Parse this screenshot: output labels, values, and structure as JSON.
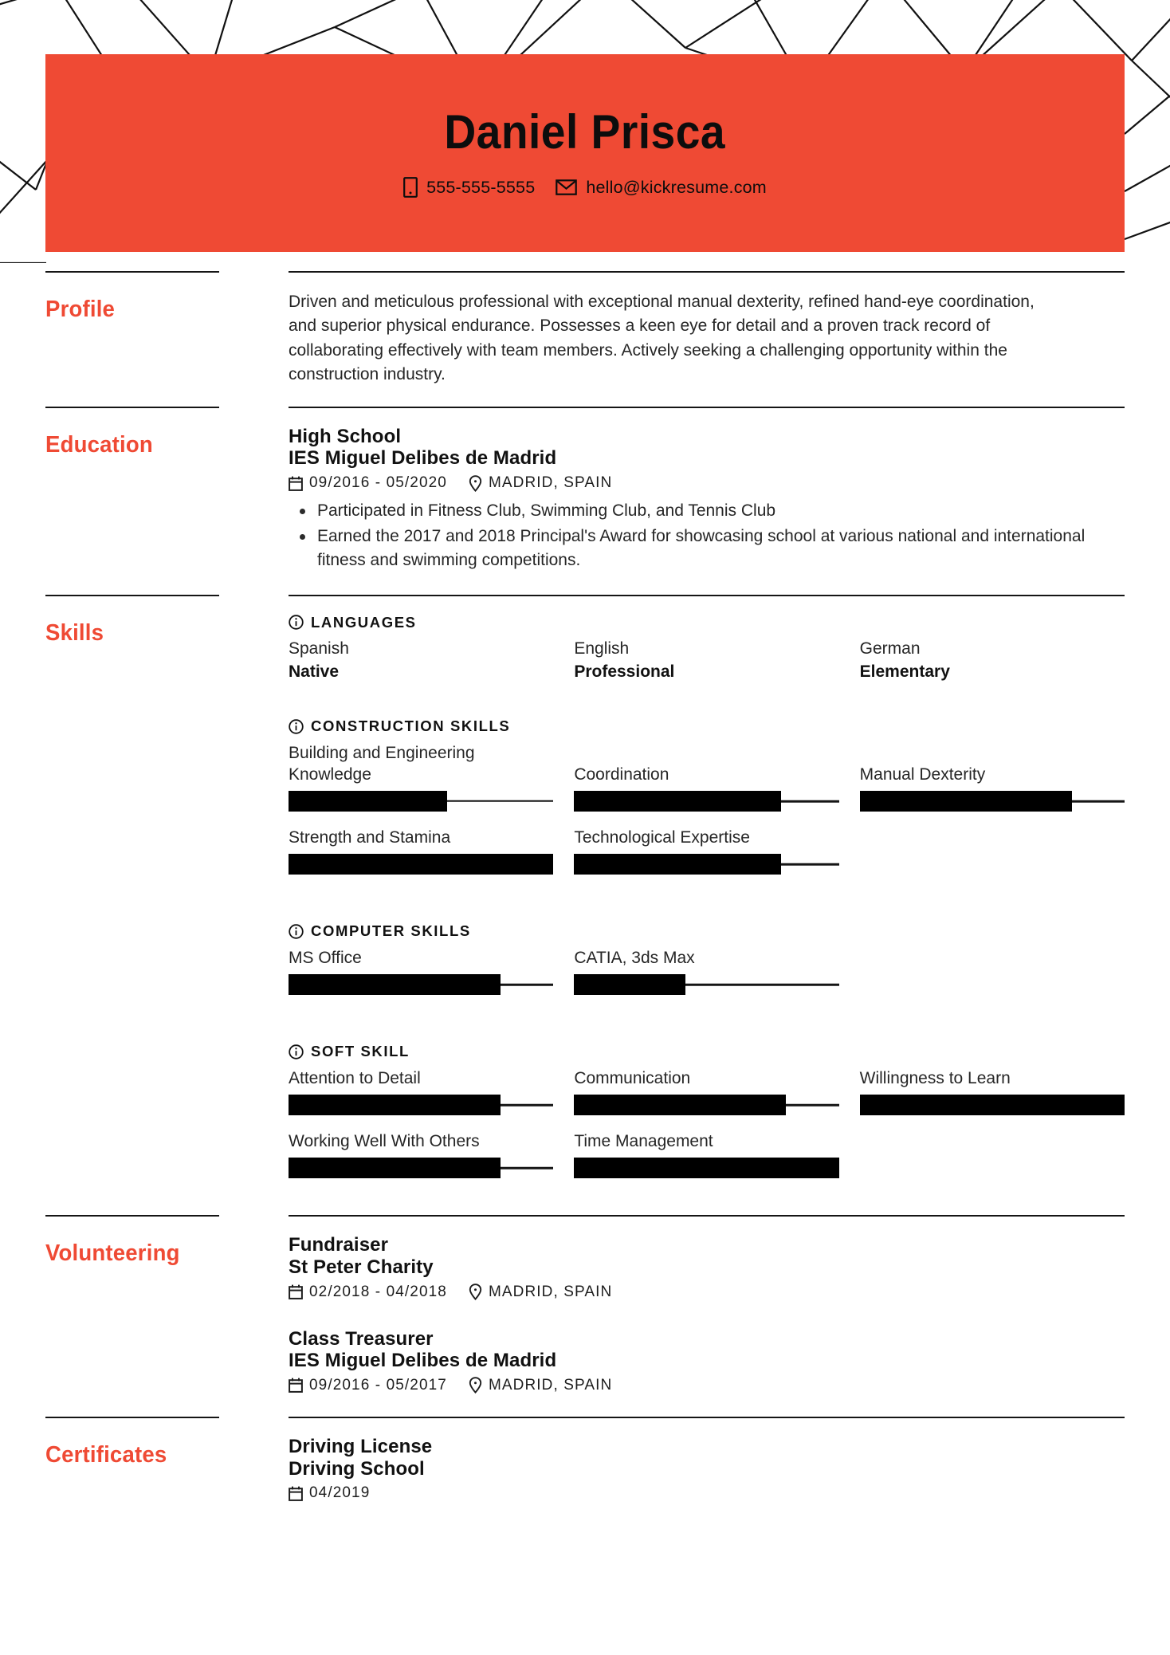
{
  "theme": {
    "accent": "#ef4a34",
    "ink": "#111111",
    "bar_fill": "#000000"
  },
  "header": {
    "name": "Daniel Prisca",
    "contacts": [
      {
        "icon": "phone-icon",
        "value": "555-555-5555"
      },
      {
        "icon": "mail-icon",
        "value": "hello@kickresume.com"
      }
    ]
  },
  "sections": {
    "profile": {
      "label": "Profile",
      "text": "Driven and meticulous professional with exceptional manual dexterity, refined hand-eye coordination, and superior physical endurance. Possesses a keen eye for detail and a proven track record of collaborating effectively with team members. Actively seeking a challenging opportunity within the construction industry."
    },
    "education": {
      "label": "Education",
      "entries": [
        {
          "title": "High School",
          "subtitle": "IES Miguel Delibes de Madrid",
          "dates": "09/2016 - 05/2020",
          "location": "MADRID, SPAIN",
          "bullets": [
            "Participated in Fitness Club, Swimming Club, and Tennis Club",
            "Earned the 2017 and 2018 Principal's Award for showcasing school at various national and international fitness and swimming competitions."
          ]
        }
      ]
    },
    "skills": {
      "label": "Skills",
      "groups": [
        {
          "heading": "LANGUAGES",
          "kind": "languages",
          "items": [
            {
              "name": "Spanish",
              "level": "Native"
            },
            {
              "name": "English",
              "level": "Professional"
            },
            {
              "name": "German",
              "level": "Elementary"
            }
          ]
        },
        {
          "heading": "CONSTRUCTION SKILLS",
          "kind": "bars",
          "items": [
            {
              "name": "Building and Engineering Knowledge",
              "value": 60
            },
            {
              "name": "Coordination",
              "value": 78
            },
            {
              "name": "Manual Dexterity",
              "value": 80
            },
            {
              "name": "Strength and Stamina",
              "value": 100
            },
            {
              "name": "Technological Expertise",
              "value": 78
            }
          ]
        },
        {
          "heading": "COMPUTER SKILLS",
          "kind": "bars",
          "items": [
            {
              "name": "MS Office",
              "value": 80
            },
            {
              "name": "CATIA, 3ds Max",
              "value": 42
            }
          ]
        },
        {
          "heading": "SOFT SKILL",
          "kind": "bars",
          "items": [
            {
              "name": "Attention to Detail",
              "value": 80
            },
            {
              "name": "Communication",
              "value": 80
            },
            {
              "name": "Willingness to Learn",
              "value": 100
            },
            {
              "name": "Working Well With Others",
              "value": 80
            },
            {
              "name": "Time Management",
              "value": 100
            }
          ]
        }
      ]
    },
    "volunteering": {
      "label": "Volunteering",
      "entries": [
        {
          "title": "Fundraiser",
          "subtitle": "St Peter Charity",
          "dates": "02/2018 - 04/2018",
          "location": "MADRID, SPAIN"
        },
        {
          "title": "Class Treasurer",
          "subtitle": "IES Miguel Delibes de Madrid",
          "dates": "09/2016 - 05/2017",
          "location": "MADRID, SPAIN"
        }
      ]
    },
    "certificates": {
      "label": "Certificates",
      "entries": [
        {
          "title": "Driving License",
          "subtitle": "Driving School",
          "dates": "04/2019",
          "location": ""
        }
      ]
    }
  }
}
